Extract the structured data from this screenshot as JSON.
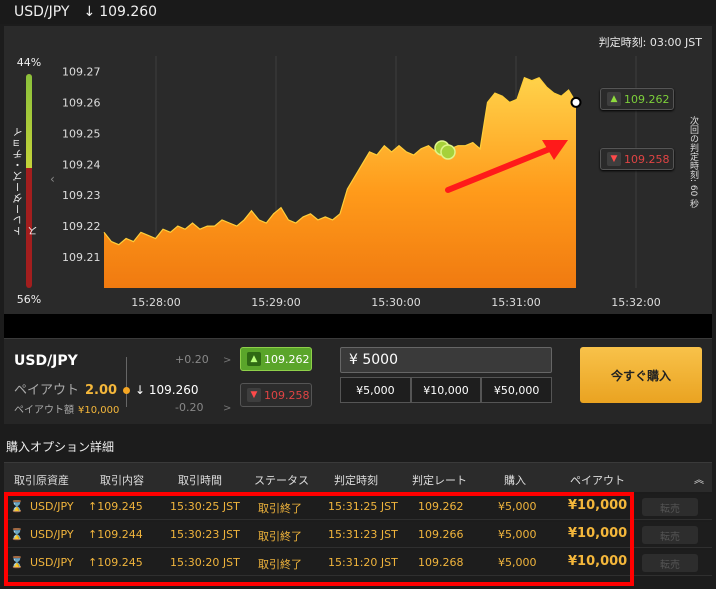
{
  "header": {
    "pair": "USD/JPY",
    "arrow": "↓",
    "rate": "109.260"
  },
  "chart": {
    "judge_time": "判定時刻: 03:00 JST",
    "sentiment": {
      "label": "トレーダーズ・チョイス",
      "top_percent": "44%",
      "bottom_percent": "56%",
      "up_ratio": 0.44
    },
    "next_judge": "次回の判定時刻: 60 秒",
    "high_label": "109.262",
    "low_label": "109.258",
    "accent_color": "#f5a623"
  },
  "chart_data": {
    "type": "area",
    "x_ticks": [
      "15:28:00",
      "15:29:00",
      "15:30:00",
      "15:31:00",
      "15:32:00"
    ],
    "y_ticks": [
      "109.27",
      "109.26",
      "109.25",
      "109.24",
      "109.23",
      "109.22",
      "109.21"
    ],
    "ylim": [
      109.2,
      109.275
    ],
    "values": [
      109.218,
      109.215,
      109.214,
      109.216,
      109.215,
      109.218,
      109.217,
      109.216,
      109.219,
      109.218,
      109.22,
      109.219,
      109.221,
      109.219,
      109.22,
      109.22,
      109.222,
      109.221,
      109.22,
      109.222,
      109.225,
      109.222,
      109.221,
      109.224,
      109.226,
      109.222,
      109.221,
      109.223,
      109.224,
      109.222,
      109.223,
      109.222,
      109.224,
      109.232,
      109.236,
      109.24,
      109.244,
      109.243,
      109.246,
      109.244,
      109.246,
      109.244,
      109.243,
      109.245,
      109.246,
      109.244,
      109.247,
      109.245,
      109.246,
      109.246,
      109.247,
      109.245,
      109.26,
      109.263,
      109.262,
      109.26,
      109.261,
      109.268,
      109.267,
      109.268,
      109.265,
      109.263,
      109.262,
      109.264,
      109.26
    ],
    "grid": true
  },
  "trade": {
    "pair": "USD/JPY",
    "payout_label": "ペイアウト",
    "payout_value": "2.00",
    "payamt_label": "ペイアウト額",
    "payamt_value": "¥10,000",
    "plus": "+0.20",
    "minus": "-0.20",
    "current_arrow": "↓",
    "current": "109.260",
    "high": "109.262",
    "low": "109.258",
    "amount": "¥ 5000",
    "amount_buttons": [
      "¥5,000",
      "¥10,000",
      "¥50,000"
    ],
    "buy_label": "今すぐ購入"
  },
  "details": {
    "title": "購入オプション詳細",
    "headers": [
      "取引原資産",
      "取引内容",
      "取引時間",
      "ステータス",
      "判定時刻",
      "判定レート",
      "購入",
      "ペイアウト"
    ],
    "resale_label": "転売",
    "rows": [
      {
        "asset": "USD/JPY",
        "content": "109.245",
        "time": "15:30:25 JST",
        "status": "取引終了",
        "judge": "15:31:25 JST",
        "rate": "109.262",
        "buy": "¥5,000",
        "payout": "¥10,000"
      },
      {
        "asset": "USD/JPY",
        "content": "109.244",
        "time": "15:30:23 JST",
        "status": "取引終了",
        "judge": "15:31:23 JST",
        "rate": "109.266",
        "buy": "¥5,000",
        "payout": "¥10,000"
      },
      {
        "asset": "USD/JPY",
        "content": "109.245",
        "time": "15:30:20 JST",
        "status": "取引終了",
        "judge": "15:31:20 JST",
        "rate": "109.268",
        "buy": "¥5,000",
        "payout": "¥10,000"
      }
    ]
  }
}
